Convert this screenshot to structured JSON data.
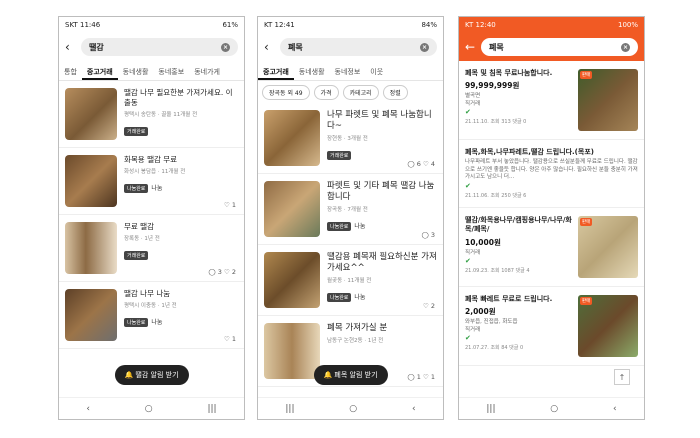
{
  "p1": {
    "status_left": "SKT 11:46",
    "status_right": "61%",
    "query": "땔감",
    "tabs": [
      "통합",
      "중고거래",
      "동네생활",
      "동네홍보",
      "동네가게"
    ],
    "items": [
      {
        "title": "땔감 나무 필요한분 가져가세요. 이출동",
        "meta": "평택시 송탄동 · 끌올 11개월 전",
        "badge": "거래완료",
        "share": "",
        "stats": ""
      },
      {
        "title": "화목용 땔감 무료",
        "meta": "화성시 봉담읍 · 11개월 전",
        "badge": "나눔완료",
        "share": "나눔",
        "stats": "♡ 1"
      },
      {
        "title": "무료 땔감",
        "meta": "장록동 · 1년 전",
        "badge": "거래완료",
        "share": "",
        "stats": "◯ 3 ♡ 2"
      },
      {
        "title": "땔감 나무 나눔",
        "meta": "평택시 이충동 · 1년 전",
        "badge": "나눔완료",
        "share": "나눔",
        "stats": "♡ 1"
      }
    ],
    "alert": "땔감 알림 받기"
  },
  "p2": {
    "status_left": "KT 12:41",
    "status_right": "84%",
    "query": "폐목",
    "tabs": [
      "중고거래",
      "동네생활",
      "동네정보",
      "이웃"
    ],
    "filters": [
      "장곡동 외 49",
      "가격",
      "카테고리",
      "정렬"
    ],
    "items": [
      {
        "title": "나무 파렛트 및 폐목 나눔합니다~",
        "meta": "장현동 · 3개월 전",
        "badge": "거래완료",
        "share": "",
        "stats": "◯ 6 ♡ 4"
      },
      {
        "title": "파렛트 및 기타 폐목 땔감 나눔합니다",
        "meta": "장곡동 · 7개월 전",
        "badge": "나눔완료",
        "share": "나눔",
        "stats": "◯ 3"
      },
      {
        "title": "땔감용 폐목재 필요하신분 가져가세요^^",
        "meta": "월곶동 · 11개월 전",
        "badge": "나눔완료",
        "share": "나눔",
        "stats": "♡ 2"
      },
      {
        "title": "폐목 가져가실 분",
        "meta": "남동구 논현2동 · 1년 전",
        "badge": "",
        "share": "",
        "stats": "◯ 1 ♡ 1"
      }
    ],
    "alert": "폐목 알림 받기"
  },
  "p3": {
    "status_left": "KT 12:40",
    "status_right": "100%",
    "query": "폐목",
    "items": [
      {
        "title": "폐목 및 침목 무료나눔합니다.",
        "price": "99,999,999원",
        "body": "별곡면\n직거래",
        "meta": "21.11.10. 조회 313 댓글 0",
        "sale": "판매"
      },
      {
        "title": "폐목,화목,나무파레트,땔감 드립니다.(목포)",
        "price": "",
        "body": "나무파레트 부서 놓았읍니다. 땔감용으로 쓰실분들께 무료로 드립니다. 땔감으로 쓰기엔 좋을듯 합니다. 양은 아주 많습니다. 필요하신 분들 충분히 가져가시고도 남으니 더...",
        "meta": "21.11.06. 조회 250 댓글 6",
        "sale": ""
      },
      {
        "title": "땔감/화목용나무/캠핑용나무/나무/화목/폐목/",
        "price": "10,000원",
        "body": "직거래",
        "meta": "21.09.23. 조회 1087 댓글 4",
        "sale": "판매"
      },
      {
        "title": "폐목 빠레트 무료로 드립니다.",
        "price": "2,000원",
        "body": "와부읍, 진접읍, 화도읍\n직거래",
        "meta": "21.07.27. 조회 84 댓글 0",
        "sale": "판매"
      }
    ]
  },
  "colors": {
    "accent": "#f15a24",
    "badge": "#444444",
    "check": "#2e9e41"
  },
  "icons": {
    "back": "arrow-left-icon",
    "clear": "close-circle-icon",
    "bell": "bell-icon",
    "share": "heart-icon"
  }
}
